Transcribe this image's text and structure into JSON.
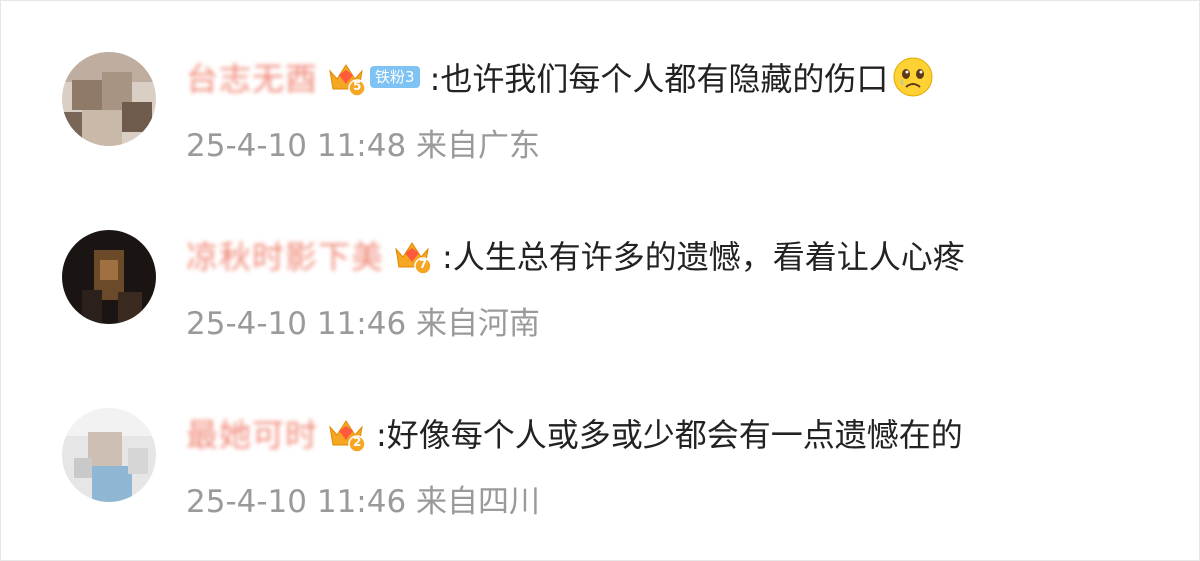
{
  "comments": [
    {
      "username": "台志无酉",
      "level_number": "5",
      "fan_badge": "铁粉3",
      "text": ":也许我们每个人都有隐藏的伤口",
      "emoji": "crying-face-icon",
      "date": "25-4-10 11:48",
      "location": "来自广东"
    },
    {
      "username": "凉秋时影下美",
      "level_number": "7",
      "text": ":人生总有许多的遗憾，看着让人心疼",
      "date": "25-4-10 11:46",
      "location": "来自河南"
    },
    {
      "username": "最她可时",
      "level_number": "2",
      "text": ":好像每个人或多或少都会有一点遗憾在的",
      "date": "25-4-10 11:46",
      "location": "来自四川"
    }
  ],
  "colors": {
    "username": "#f08a78",
    "meta": "#9a9a9a",
    "text": "#222222",
    "crown": "#f5a623",
    "fan_badge": "#7ec3f3"
  }
}
